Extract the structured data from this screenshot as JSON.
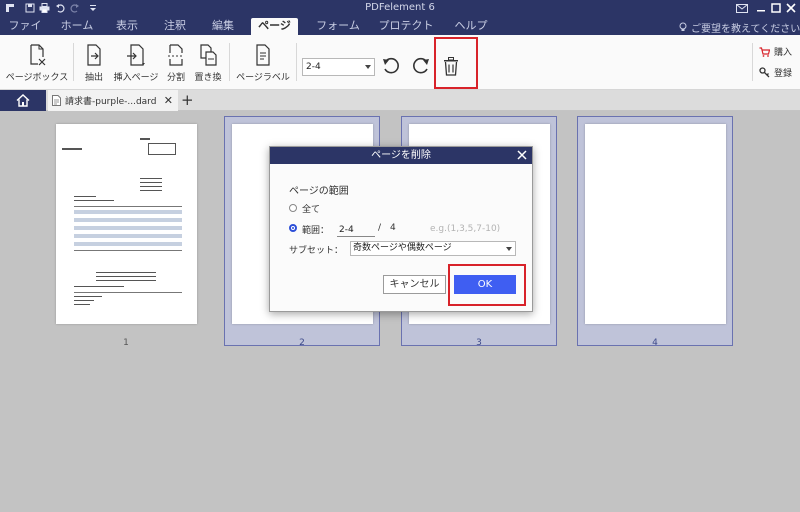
{
  "titlebar": {
    "title": "PDFelement 6"
  },
  "menu": {
    "items": [
      "ファイル",
      "ホーム",
      "表示",
      "注釈",
      "編集",
      "ページ",
      "フォーム",
      "プロテクト",
      "ヘルプ"
    ],
    "active": "ページ",
    "help_placeholder": "ご要望を教えてください..."
  },
  "toolbar": {
    "page_box": "ページボックス",
    "extract": "抽出",
    "insert": "挿入ページ",
    "split": "分割",
    "replace": "置き換",
    "page_label": "ページラベル",
    "range_value": "2-4",
    "purchase": "購入",
    "register": "登録"
  },
  "tabs": {
    "doc_name": "請求書-purple-...dard"
  },
  "pages": [
    "1",
    "2",
    "3",
    "4"
  ],
  "dialog": {
    "title": "ページを削除",
    "range_heading": "ページの範囲",
    "all_label": "全て",
    "range_label": "範囲：",
    "range_value": "2-4",
    "separator": "/",
    "total": "4",
    "hint": "e.g.(1,3,5,7-10)",
    "subset_label": "サブセット：",
    "subset_value": "奇数ページや偶数ページ",
    "cancel": "キャンセル",
    "ok": "OK"
  },
  "colors": {
    "navy": "#2c3566",
    "highlight": "#d8232a",
    "ok_blue": "#3f5ef2"
  }
}
